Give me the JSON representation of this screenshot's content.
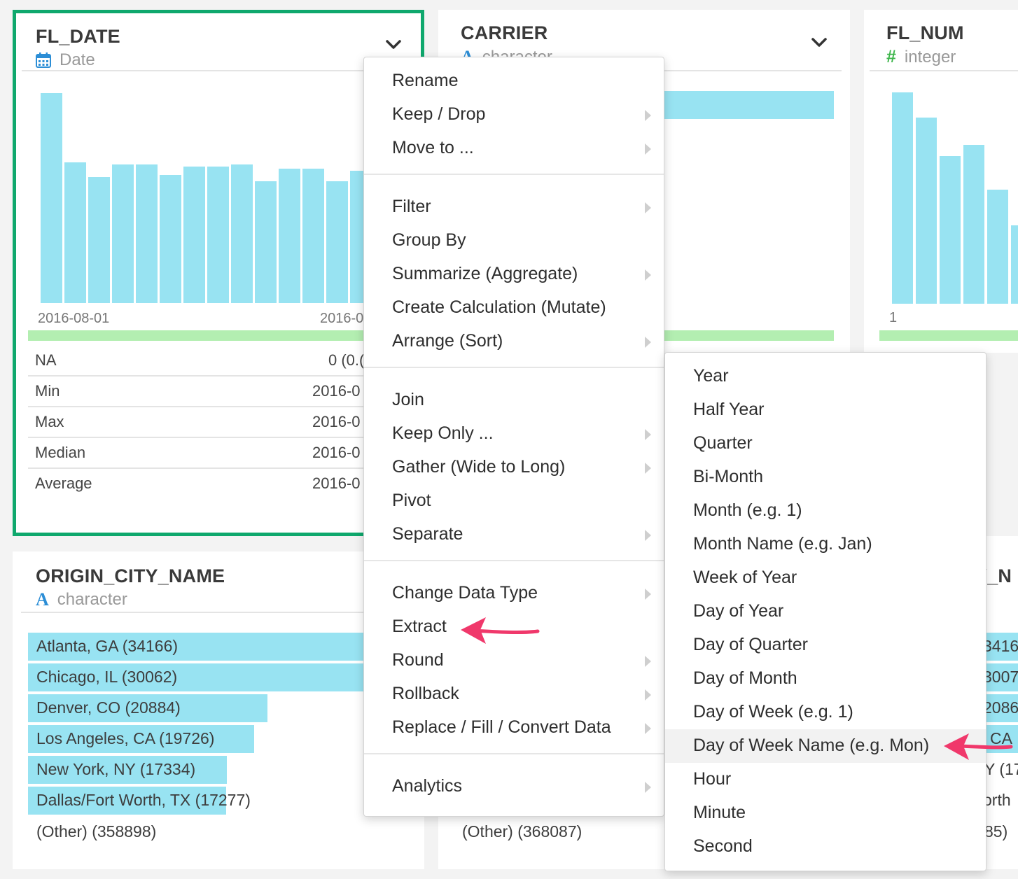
{
  "cards": {
    "fl_date": {
      "title": "FL_DATE",
      "type_label": "Date",
      "type_icon": "calendar-icon",
      "axis_start": "2016-08-01",
      "axis_end_partial": "2016-0",
      "bar_values": [
        100,
        67,
        60,
        66,
        66,
        61,
        65,
        65,
        66,
        58,
        64,
        64,
        58,
        63
      ],
      "stats": [
        {
          "label": "NA",
          "value": "0 (0.("
        },
        {
          "label": "Min",
          "value": "2016-0"
        },
        {
          "label": "Max",
          "value": "2016-0"
        },
        {
          "label": "Median",
          "value": "2016-0"
        },
        {
          "label": "Average",
          "value": "2016-0"
        }
      ]
    },
    "carrier": {
      "title": "CARRIER",
      "type_label": "character",
      "type_icon": "character-icon",
      "bar_fractions": [
        1.0,
        0.47,
        0.36
      ]
    },
    "fl_num": {
      "title": "FL_NUM",
      "type_label": "integer",
      "type_icon": "hash-icon",
      "axis_start": "1",
      "bar_values": [
        100,
        88,
        70,
        75,
        54,
        37
      ]
    },
    "origin_city_name": {
      "title": "ORIGIN_CITY_NAME",
      "type_label": "character",
      "type_icon": "character-icon",
      "rows": [
        {
          "label": "Atlanta, GA (34166)",
          "fraction": 1.0
        },
        {
          "label": "Chicago, IL (30062)",
          "fraction": 0.88
        },
        {
          "label": "Denver, CO (20884)",
          "fraction": 0.611
        },
        {
          "label": "Los Angeles, CA (19726)",
          "fraction": 0.577
        },
        {
          "label": "New York, NY (17334)",
          "fraction": 0.507
        },
        {
          "label": "Dallas/Fort Worth, TX (17277)",
          "fraction": 0.506
        }
      ],
      "other": "(Other) (358898)"
    },
    "dest_city_name": {
      "title_partial": "Y_N",
      "row_partials": [
        "3416",
        "3007",
        "2086",
        "CA",
        "Y (17",
        "orth"
      ],
      "other": "(Other) (368087)",
      "other_partial": "85)"
    }
  },
  "context_menu": {
    "groups": [
      [
        {
          "label": "Rename",
          "submenu": false
        },
        {
          "label": "Keep / Drop",
          "submenu": true
        },
        {
          "label": "Move to ...",
          "submenu": true
        }
      ],
      [
        {
          "label": "Filter",
          "submenu": true
        },
        {
          "label": "Group By",
          "submenu": false
        },
        {
          "label": "Summarize (Aggregate)",
          "submenu": true
        },
        {
          "label": "Create Calculation (Mutate)",
          "submenu": false
        },
        {
          "label": "Arrange (Sort)",
          "submenu": true
        }
      ],
      [
        {
          "label": "Join",
          "submenu": false
        },
        {
          "label": "Keep Only ...",
          "submenu": true
        },
        {
          "label": "Gather (Wide to Long)",
          "submenu": true
        },
        {
          "label": "Pivot",
          "submenu": false
        },
        {
          "label": "Separate",
          "submenu": true
        }
      ],
      [
        {
          "label": "Change Data Type",
          "submenu": true
        },
        {
          "label": "Extract",
          "submenu": false
        },
        {
          "label": "Round",
          "submenu": true
        },
        {
          "label": "Rollback",
          "submenu": true
        },
        {
          "label": "Replace / Fill / Convert Data",
          "submenu": true
        }
      ],
      [
        {
          "label": "Analytics",
          "submenu": true
        }
      ]
    ]
  },
  "extract_submenu": {
    "items": [
      "Year",
      "Half Year",
      "Quarter",
      "Bi-Month",
      "Month (e.g. 1)",
      "Month Name (e.g. Jan)",
      "Week of Year",
      "Day of Year",
      "Day of Quarter",
      "Day of Month",
      "Day of Week (e.g. 1)",
      "Day of Week Name (e.g. Mon)",
      "Hour",
      "Minute",
      "Second"
    ],
    "highlighted": "Day of Week Name (e.g. Mon)"
  },
  "colors": {
    "selected_border": "#0fa86d",
    "bar": "#98e3f2",
    "na_strip": "#b3eeb1",
    "annotation_arrow": "#f0386b"
  }
}
